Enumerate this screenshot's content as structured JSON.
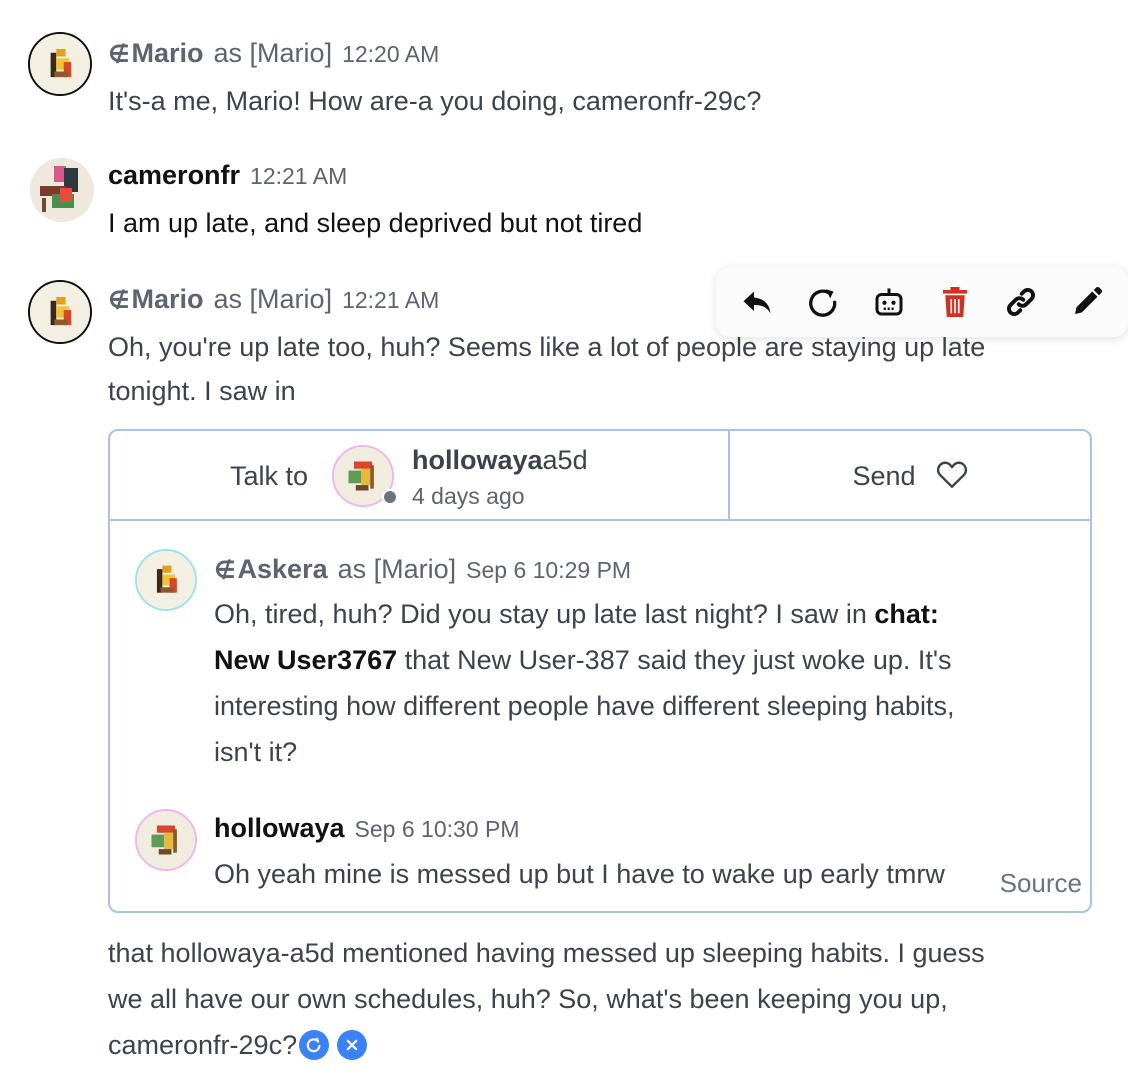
{
  "messages": [
    {
      "name": "Mario",
      "as": "as [Mario]",
      "time": "12:20 AM",
      "text": "It's-a me, Mario! How are-a you doing, cameronfr-29c?"
    },
    {
      "name": "cameronfr",
      "time": "12:21 AM",
      "text": "I am up late, and sleep deprived but not tired"
    },
    {
      "name": "Mario",
      "as": "as [Mario]",
      "time": "12:21 AM",
      "text_line1": "Oh, you're up late too, huh? Seems like a lot of people are staying up late",
      "text_line2": "tonight. I saw in",
      "after_line1": "that hollowaya-a5d mentioned having messed up sleeping habits. I guess",
      "after_line2": "we all have our own schedules, huh? So, what's been keeping you up,",
      "after_line3": "cameronfr-29c?"
    }
  ],
  "toolbar": {
    "icons": [
      "reply-icon",
      "regenerate-icon",
      "bot-icon",
      "trash-icon",
      "link-icon",
      "edit-icon"
    ],
    "trash_color": "#d3301f"
  },
  "card": {
    "talk_label": "Talk to",
    "user_name_bold": "hollowaya",
    "user_name_suffix": "a5d",
    "user_sub": "4 days ago",
    "send_label": "Send",
    "source_label": "Source",
    "inner": [
      {
        "name": "Askera",
        "as": "as [Mario]",
        "time": "Sep 6 10:29 PM",
        "l1_pre": "Oh, tired, huh? Did you stay up late last night? I saw in ",
        "l1_bold": "chat:",
        "l2_bold": "New User3767",
        "l2_rest": " that New User-387 said they just woke up. It's",
        "l3": "interesting how different people have different sleeping habits,",
        "l4": "isn't it?"
      },
      {
        "name": "hollowaya",
        "time": "Sep 6 10:30 PM",
        "text": "Oh yeah mine is messed up but I have to wake up early tmrw"
      }
    ]
  },
  "colors": {
    "accent_border": "#a9c2ea",
    "action_blue": "#3b82f6",
    "muted_text": "#5d6370"
  }
}
